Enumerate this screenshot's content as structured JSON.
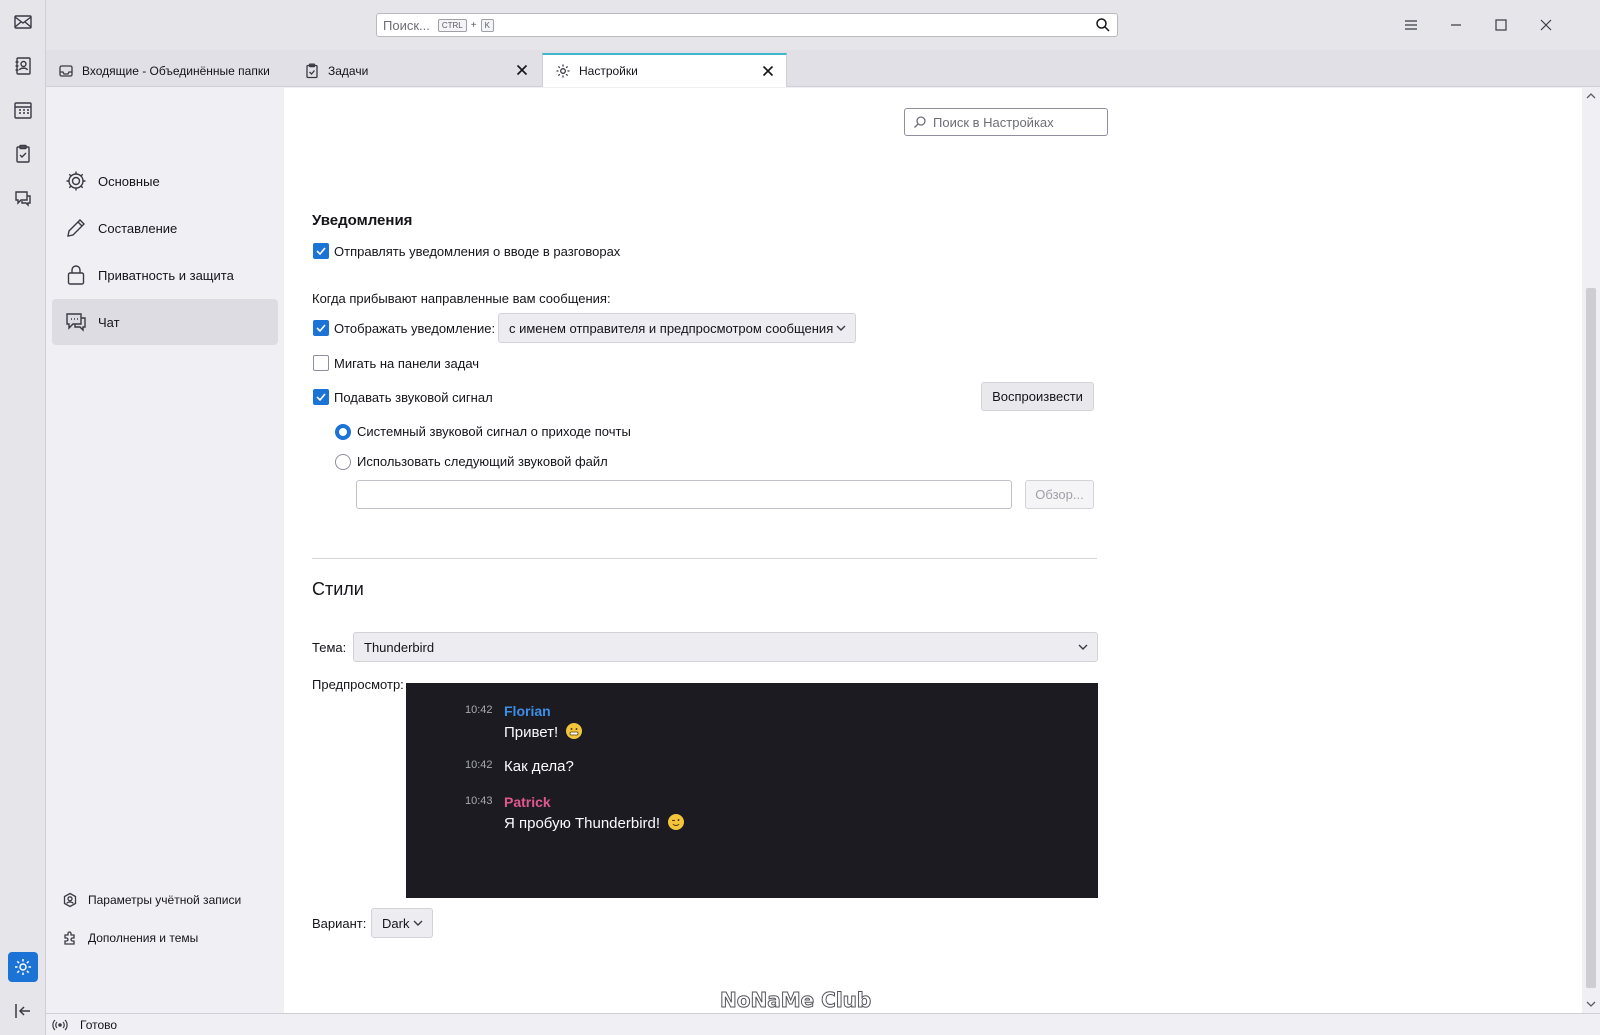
{
  "search": {
    "placeholder": "Поиск...",
    "kbd_mod": "CTRL",
    "kbd_plus": "+",
    "kbd_key": "K"
  },
  "tabs": [
    {
      "label": "Входящие - Объединённые папки",
      "icon": "inbox-icon"
    },
    {
      "label": "Задачи",
      "icon": "tasks-icon"
    },
    {
      "label": "Настройки",
      "icon": "gear-icon",
      "selected": true
    }
  ],
  "sidebar": {
    "categories": [
      {
        "label": "Основные",
        "icon": "gear-icon"
      },
      {
        "label": "Составление",
        "icon": "pencil-icon"
      },
      {
        "label": "Приватность и защита",
        "icon": "lock-icon"
      },
      {
        "label": "Чат",
        "icon": "chat-icon",
        "selected": true
      }
    ],
    "footer": [
      {
        "label": "Параметры учётной записи",
        "icon": "account-icon"
      },
      {
        "label": "Дополнения и темы",
        "icon": "puzzle-icon"
      }
    ]
  },
  "prefs": {
    "search_placeholder": "Поиск в Настройках",
    "notifications": {
      "title": "Уведомления",
      "typing_label": "Отправлять уведомления о вводе в разговорах",
      "typing_checked": true,
      "when_label": "Когда прибывают направленные вам сообщения:",
      "show_label": "Отображать уведомление:",
      "show_checked": true,
      "show_value": "с именем отправителя и предпросмотром сообщения",
      "flash_label": "Мигать на панели задач",
      "flash_checked": false,
      "sound_label": "Подавать звуковой сигнал",
      "sound_checked": true,
      "play_label": "Воспроизвести",
      "system_sound_label": "Системный звуковой сигнал о приходе почты",
      "custom_sound_label": "Использовать следующий звуковой файл",
      "sound_file_value": "",
      "browse_label": "Обзор..."
    },
    "styles": {
      "title": "Стили",
      "theme_label": "Тема:",
      "theme_value": "Thunderbird",
      "preview_label": "Предпросмотр:",
      "variant_label": "Вариант:",
      "variant_value": "Dark",
      "messages": [
        {
          "time": "10:42",
          "nick": "Florian",
          "nick_color": "#3b8fe8",
          "text": "Привет!",
          "emoji": "grin"
        },
        {
          "time": "10:42",
          "nick": "",
          "text": "Как дела?"
        },
        {
          "time": "10:43",
          "nick": "Patrick",
          "nick_color": "#e0588f",
          "text": "Я пробую Thunderbird!",
          "emoji": "wink"
        }
      ]
    }
  },
  "status": {
    "text": "Готово"
  },
  "watermark": "NoNaMe Club",
  "colors": {
    "accent": "#1c73d6",
    "preview_bg": "#1c1b22",
    "tab_highlight": "#3fb6c9"
  }
}
